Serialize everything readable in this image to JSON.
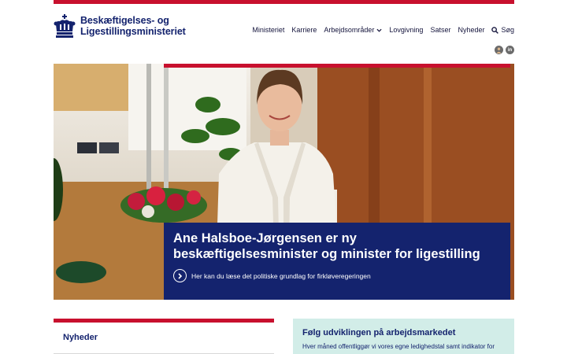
{
  "header": {
    "logo_line1": "Beskæftigelses- og",
    "logo_line2": "Ligestillingsministeriet"
  },
  "nav": {
    "items": [
      "Ministeriet",
      "Karriere",
      "Arbejdsområder",
      "Lovgivning",
      "Satser",
      "Nyheder"
    ],
    "search_label": "Søg"
  },
  "social": {
    "icons": [
      "person-icon",
      "linkedin-icon"
    ],
    "linkedin_text": "in"
  },
  "hero": {
    "title": "Ane Halsboe-Jørgensen er ny beskæftigelsesminister og minister for ligestilling",
    "link_text": "Her kan du læse det politiske grundlag for firkløveregeringen"
  },
  "news": {
    "title": "Nyheder"
  },
  "follow": {
    "title": "Følg udviklingen på arbejdsmarkedet",
    "text": "Hver måned offentliggør vi vores egne ledighedstal samt indikator for"
  },
  "colors": {
    "accent_red": "#c8102e",
    "brand_blue": "#14236e",
    "mint": "#d2ede8"
  }
}
